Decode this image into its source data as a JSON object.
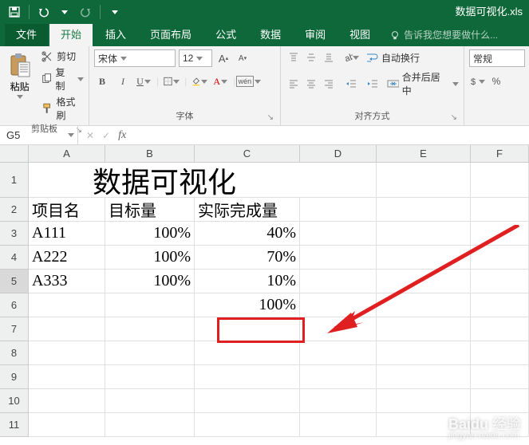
{
  "titlebar": {
    "filename": "数据可视化.xls"
  },
  "tabs": {
    "file": "文件",
    "items": [
      "开始",
      "插入",
      "页面布局",
      "公式",
      "数据",
      "审阅",
      "视图"
    ],
    "active_index": 0,
    "tellme": "告诉我您想要做什么..."
  },
  "ribbon": {
    "clipboard": {
      "paste": "粘贴",
      "cut": "剪切",
      "copy": "复制",
      "format_painter": "格式刷",
      "group": "剪贴板"
    },
    "font": {
      "name": "宋体",
      "size": "12",
      "group": "字体",
      "phonetic": "wén"
    },
    "alignment": {
      "wrap": "自动换行",
      "merge": "合并后居中",
      "group": "对齐方式"
    },
    "number": {
      "format": "常规"
    }
  },
  "namebox": {
    "ref": "G5"
  },
  "columns": [
    "A",
    "B",
    "C",
    "D",
    "E",
    "F"
  ],
  "rows": [
    "1",
    "2",
    "3",
    "4",
    "5",
    "6",
    "7",
    "8",
    "9",
    "10",
    "11"
  ],
  "sheet": {
    "title": "数据可视化",
    "headers": {
      "a": "项目名",
      "b": "目标量",
      "c": "实际完成量"
    },
    "r3": {
      "a": "A111",
      "b": "100%",
      "c": "40%"
    },
    "r4": {
      "a": "A222",
      "b": "100%",
      "c": "70%"
    },
    "r5": {
      "a": "A333",
      "b": "100%",
      "c": "10%"
    },
    "r6": {
      "c": "100%"
    }
  },
  "watermark": {
    "brand": "Baidu",
    "sub": "经验",
    "url": "jingyan.baidu.com"
  }
}
